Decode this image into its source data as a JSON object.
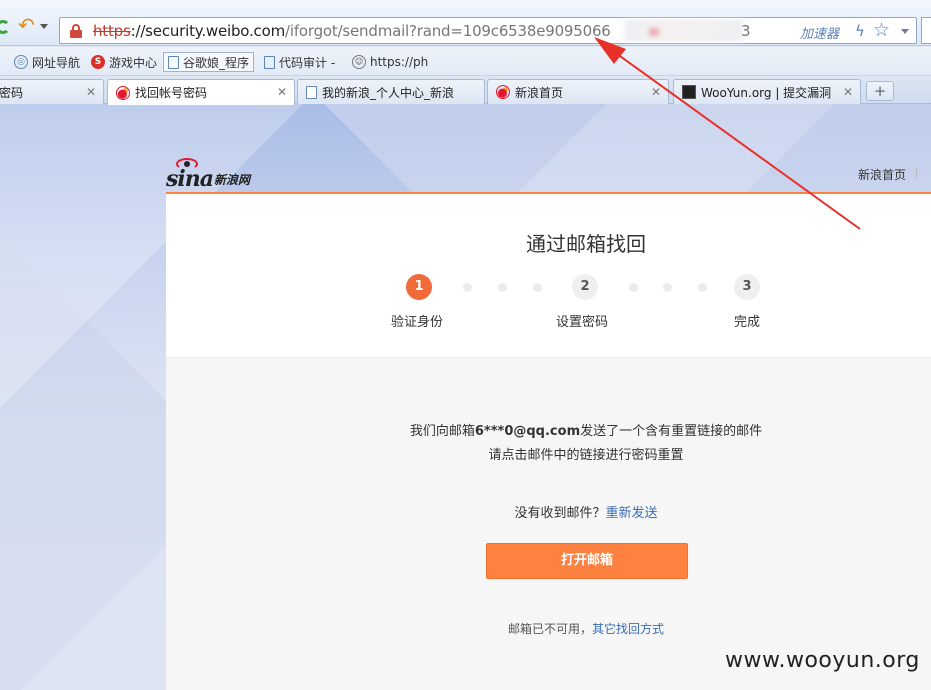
{
  "browser": {
    "url": {
      "scheme": "https",
      "host": "://security.weibo.com",
      "path": "/iforgot/sendmail?rand=109c6538e9095066",
      "tail": "3"
    },
    "accelerator_label": "加速器",
    "icons": {
      "back": "undo-arrow-icon",
      "refresh": "refresh-icon",
      "security": "broken-lock-icon",
      "lightning": "bolt-icon",
      "favorite": "star-icon"
    },
    "bookmarks": [
      {
        "label": "网址导航",
        "icon": "globe-icon"
      },
      {
        "label": "游戏中心",
        "icon": "game-icon"
      },
      {
        "label": "谷歌娘_程序",
        "icon": "doc-icon"
      },
      {
        "label": "代码审计 -",
        "icon": "doc-icon"
      },
      {
        "label": "https://ph",
        "icon": "face-icon"
      }
    ],
    "tabs": [
      {
        "label": "密码",
        "active": false
      },
      {
        "label": "找回帐号密码",
        "active": true
      },
      {
        "label": "我的新浪_个人中心_新浪",
        "active": false
      },
      {
        "label": "新浪首页",
        "active": false
      },
      {
        "label": "WooYun.org | 提交漏洞",
        "active": false
      }
    ],
    "new_tab_label": "+"
  },
  "page": {
    "logo_text": "sina",
    "logo_cn": "新浪网",
    "home_link": "新浪首页",
    "title": "通过邮箱找回",
    "steps": [
      {
        "num": "1",
        "label": "验证身份",
        "state": "active"
      },
      {
        "num": "2",
        "label": "设置密码",
        "state": "todo"
      },
      {
        "num": "3",
        "label": "完成",
        "state": "todo"
      }
    ],
    "message_prefix": "我们向邮箱",
    "email": "6***0@qq.com",
    "message_suffix": "发送了一个含有重置链接的邮件",
    "message_line2": "请点击邮件中的链接进行密码重置",
    "resend_prefix": "没有收到邮件？",
    "resend_link": "重新发送",
    "open_mail_button": "打开邮箱",
    "alt_prefix": "邮箱已不可用，",
    "alt_link": "其它找回方式"
  },
  "watermark": "www.wooyun.org",
  "colors": {
    "accent": "#ff8140",
    "step_active": "#f06a3a",
    "link": "#3b6db3",
    "annotation_arrow": "#e8302a"
  }
}
